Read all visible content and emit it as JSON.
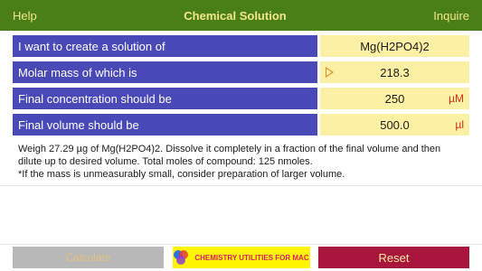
{
  "nav": {
    "left": "Help",
    "title": "Chemical Solution",
    "right": "Inquire"
  },
  "form": {
    "compound_label": "I want to create a solution of",
    "compound_value": "Mg(H2PO4)2",
    "molar_label": "Molar mass of which is",
    "molar_value": "218.3",
    "conc_label": "Final concentration should be",
    "conc_value": "250",
    "conc_unit": "µM",
    "volume_label": "Final volume should be",
    "volume_value": "500.0",
    "volume_unit": "µl"
  },
  "result": {
    "line1": "Weigh 27.29 µg of Mg(H2PO4)2. Dissolve it completely in a fraction of the final volume and then dilute up to desired volume. Total moles of compound: 125 nmoles.",
    "line2": "*If the mass is unmeasurably small, consider preparation of larger volume."
  },
  "footer": {
    "calculate": "Calculate",
    "promo": "CHEMISTRY UTILITIES FOR MAC",
    "reset": "Reset"
  },
  "colors": {
    "nav_bg": "#4a7f17",
    "label_bg": "#4a49b8",
    "value_bg": "#fbf0a3",
    "reset_bg": "#a8163e",
    "promo_bg": "#fff500"
  }
}
